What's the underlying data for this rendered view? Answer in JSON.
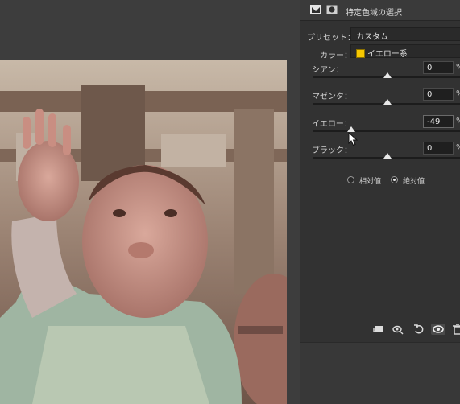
{
  "panel": {
    "title": "特定色域の選択",
    "header_icons": [
      "adjustment-layer-icon",
      "mask-icon"
    ],
    "preset_label": "プリセット：",
    "preset_value": "カスタム",
    "color_label": "カラー：",
    "color_value": "イエロー系",
    "color_swatch": "#f6c700",
    "sliders": [
      {
        "label": "シアン：",
        "value": "0",
        "unit": "%",
        "level": 0
      },
      {
        "label": "マゼンタ：",
        "value": "0",
        "unit": "%",
        "level": 0
      },
      {
        "label": "イエロー：",
        "value": "-49",
        "unit": "%",
        "level": -49
      },
      {
        "label": "ブラック：",
        "value": "0",
        "unit": "%",
        "level": 0
      }
    ],
    "method": {
      "relative_label": "相対値",
      "absolute_label": "絶対値",
      "selected": "absolute"
    },
    "toolbar_icons": [
      "clip-to-layer-icon",
      "view-previous-state-icon",
      "reset-icon",
      "visibility-eye-icon",
      "delete-icon"
    ]
  }
}
